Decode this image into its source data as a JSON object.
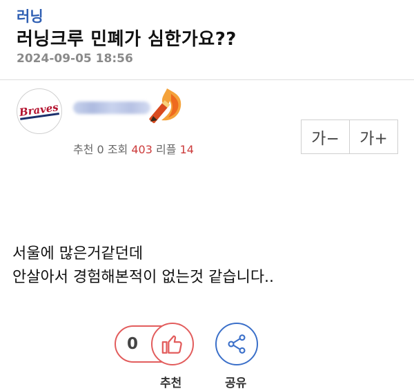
{
  "post": {
    "category": "러닝",
    "title": "러닝크루 민폐가 심한가요??",
    "datetime": "2024-09-05 18:56"
  },
  "author": {
    "avatar_text": "Braves",
    "badge_icon": "fire-pencil-icon"
  },
  "stats": {
    "recommend_label": "추천",
    "recommend_value": "0",
    "views_label": "조회",
    "views_value": "403",
    "replies_label": "리플",
    "replies_value": "14"
  },
  "font_controls": {
    "decrease": "가−",
    "increase": "가+"
  },
  "body": {
    "lines": [
      "서울에 많은거같던데",
      "안살아서 경험해본적이 없는것 같습니다.."
    ]
  },
  "actions": {
    "recommend_count": "0",
    "recommend_label": "추천",
    "share_label": "공유",
    "recommend_icon": "thumbs-up-icon",
    "share_icon": "share-icon"
  },
  "colors": {
    "category": "#2f5fb3",
    "highlight": "#cc3b3b",
    "recommend": "#e25c5c",
    "share": "#3a6fc9"
  }
}
